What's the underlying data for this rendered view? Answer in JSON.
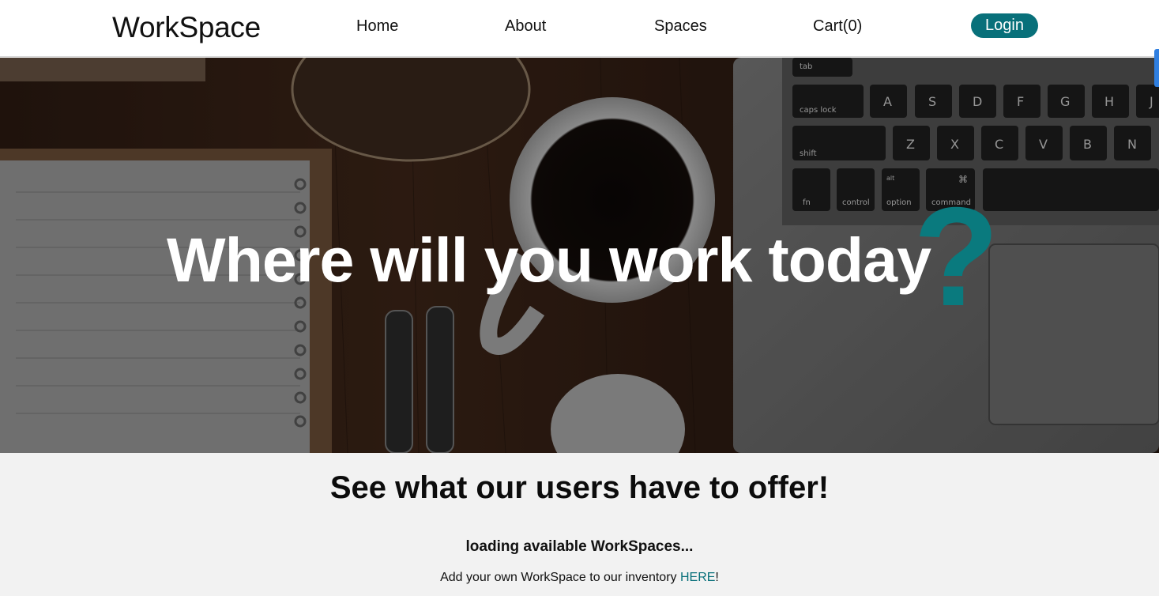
{
  "navbar": {
    "brand": "WorkSpace",
    "links": {
      "home": "Home",
      "about": "About",
      "spaces": "Spaces",
      "cart": "Cart(0)"
    },
    "login_label": "Login"
  },
  "hero": {
    "title": "Where will you work today",
    "question_mark": "?",
    "keyboard_keys": {
      "tab": "tab",
      "caps_lock": "caps lock",
      "shift": "shift",
      "fn": "fn",
      "control": "control",
      "option": "option",
      "alt": "alt",
      "command": "command",
      "command_symbol": "⌘",
      "a": "A",
      "s": "S",
      "d": "D",
      "f": "F",
      "g": "G",
      "h": "H",
      "j": "J",
      "z": "Z",
      "x": "X",
      "c": "C",
      "v": "V",
      "b": "B",
      "n": "N"
    }
  },
  "offer": {
    "heading": "See what our users have to offer!",
    "loading": "loading available WorkSpaces...",
    "add_prefix": "Add your own WorkSpace to our inventory ",
    "add_link": "HERE",
    "add_suffix": "!"
  },
  "colors": {
    "accent": "#08707a",
    "question_mark": "#0a7a7e",
    "section_bg": "#f2f2f2"
  }
}
